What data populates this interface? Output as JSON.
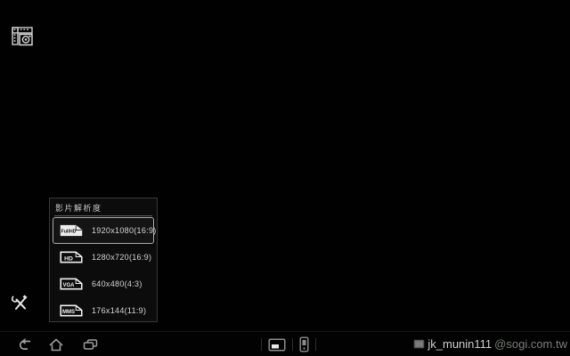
{
  "viewfinder": {
    "mode_icon": "video-mode-film-camera-icon",
    "background_color": "#000000"
  },
  "resolution_menu": {
    "title": "影片解析度",
    "selected_index": 0,
    "options": [
      {
        "badge": "FullHD",
        "label": "1920x1080(16:9)"
      },
      {
        "badge": "HD",
        "label": "1280x720(16:9)"
      },
      {
        "badge": "VGA",
        "label": "640x480(4:3)"
      },
      {
        "badge": "MMS",
        "label": "176x144(11:9)"
      }
    ],
    "colors": {
      "panel_bg": "#0c0c0c",
      "panel_border": "#383838",
      "selected_border": "#ababab",
      "text": "#d4d4d4"
    }
  },
  "controls": {
    "tools_icon": "tools-wrench-icon"
  },
  "system_bar": {
    "icons": [
      "back-icon",
      "home-icon",
      "recents-icon",
      "screenshot-icon",
      "small-apps-icon"
    ],
    "icon_color": "#9c9c9c"
  },
  "watermark": {
    "icon": "picture-icon",
    "user": "jk_munin111",
    "domain": "@sogi.com.tw"
  }
}
